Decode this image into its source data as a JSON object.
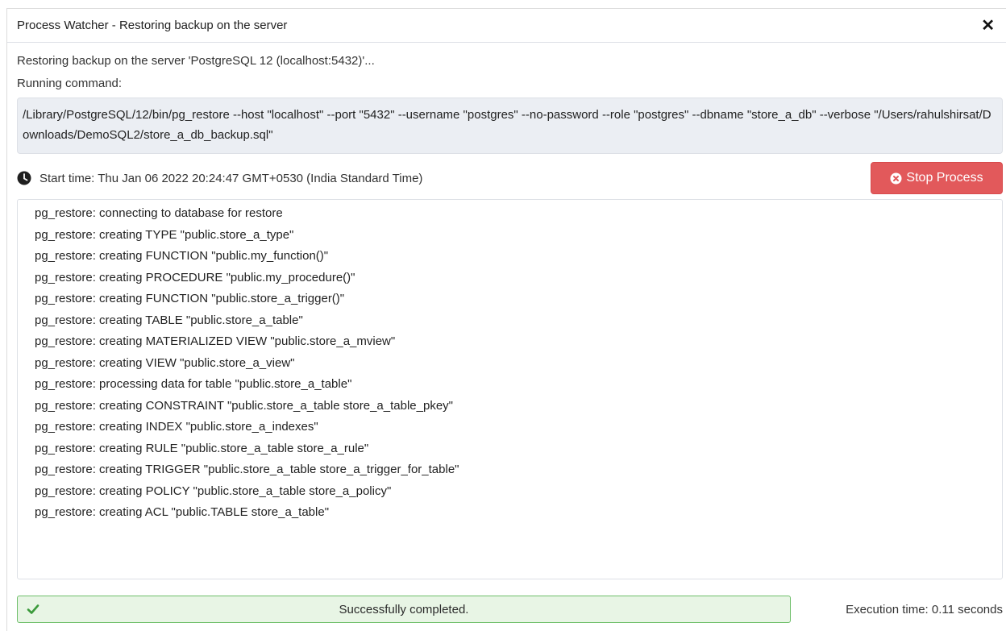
{
  "dialog": {
    "title": "Process Watcher - Restoring backup on the server",
    "message": "Restoring backup on the server 'PostgreSQL 12 (localhost:5432)'...",
    "running_label": "Running command:",
    "command": "/Library/PostgreSQL/12/bin/pg_restore --host \"localhost\" --port \"5432\" --username \"postgres\" --no-password --role \"postgres\" --dbname \"store_a_db\" --verbose \"/Users/rahulshirsat/Downloads/DemoSQL2/store_a_db_backup.sql\"",
    "start_time": "Start time: Thu Jan 06 2022 20:24:47 GMT+0530 (India Standard Time)",
    "stop_button": "Stop Process",
    "log_lines": [
      "pg_restore: connecting to database for restore",
      "pg_restore: creating TYPE \"public.store_a_type\"",
      "pg_restore: creating FUNCTION \"public.my_function()\"",
      "pg_restore: creating PROCEDURE \"public.my_procedure()\"",
      "pg_restore: creating FUNCTION \"public.store_a_trigger()\"",
      "pg_restore: creating TABLE \"public.store_a_table\"",
      "pg_restore: creating MATERIALIZED VIEW \"public.store_a_mview\"",
      "pg_restore: creating VIEW \"public.store_a_view\"",
      "pg_restore: processing data for table \"public.store_a_table\"",
      "pg_restore: creating CONSTRAINT \"public.store_a_table store_a_table_pkey\"",
      "pg_restore: creating INDEX \"public.store_a_indexes\"",
      "pg_restore: creating RULE \"public.store_a_table store_a_rule\"",
      "pg_restore: creating TRIGGER \"public.store_a_table store_a_trigger_for_table\"",
      "pg_restore: creating POLICY \"public.store_a_table store_a_policy\"",
      "pg_restore: creating ACL \"public.TABLE store_a_table\""
    ],
    "status": "Successfully completed.",
    "execution_time": "Execution time: 0.11 seconds"
  },
  "icons": {
    "close": "close-icon",
    "clock": "clock-icon",
    "stop": "times-circle-icon",
    "success": "check-icon"
  },
  "colors": {
    "danger": "#e2595b",
    "success_bg": "#e8f5e5",
    "success_border": "#6fbf6a",
    "command_bg": "#ebeef3"
  }
}
